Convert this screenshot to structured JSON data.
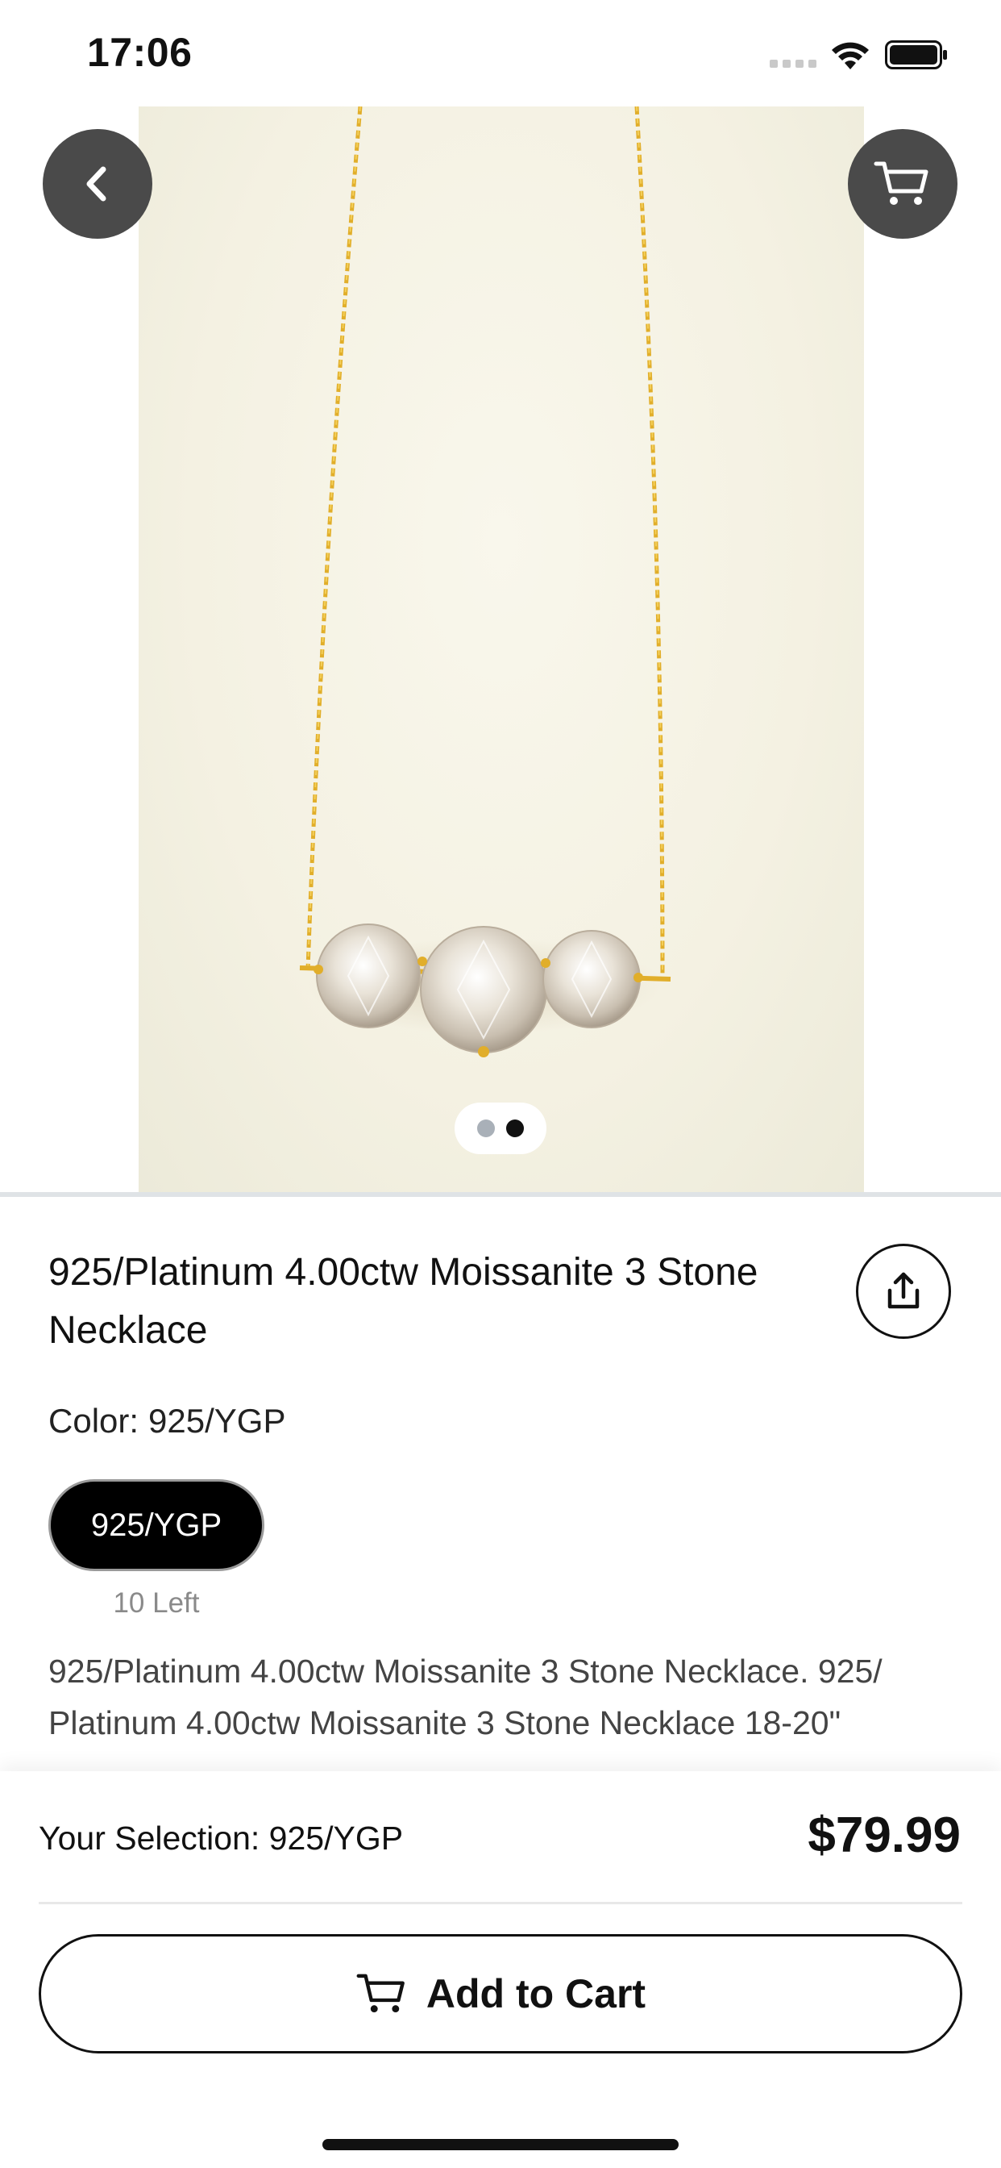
{
  "status_bar": {
    "time": "17:06"
  },
  "product": {
    "title": "925/Platinum 4.00ctw Moissanite 3 Stone Necklace",
    "color_label": "Color:",
    "color_value": "925/YGP",
    "options": [
      {
        "label": "925/YGP",
        "selected": true,
        "stock": "10 Left"
      }
    ],
    "description": "925/Platinum 4.00ctw Moissanite 3 Stone Necklace. 925/ Platinum 4.00ctw Moissanite 3 Stone Necklace 18-20\""
  },
  "gallery": {
    "page_count": 2,
    "current_page": 2
  },
  "footer": {
    "selection_text": "Your Selection: 925/YGP",
    "price": "$79.99",
    "add_to_cart_label": "Add to Cart"
  },
  "colors": {
    "accent": "#000000",
    "button_overlay": "#4a4a4a",
    "gold": "#e8b92f",
    "pager_inactive": "#a9b0b8"
  },
  "icons": [
    "back-chevron-icon",
    "cart-icon",
    "share-icon",
    "wifi-icon",
    "battery-icon",
    "signal-icon"
  ]
}
